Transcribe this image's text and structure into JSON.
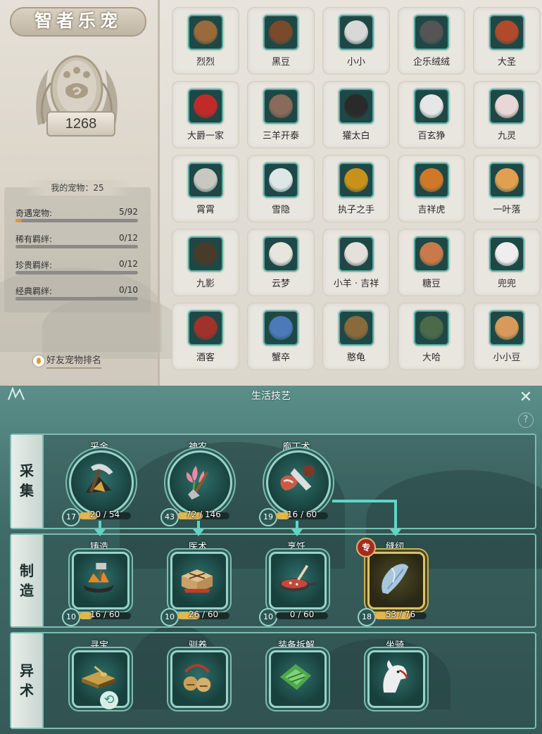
{
  "pet_panel": {
    "title": "智者乐宠",
    "score": "1268",
    "my_pets_label": "我的宠物：25",
    "stats": [
      {
        "label": "奇遇宠物:",
        "value": "5/92",
        "progress": 0.054
      },
      {
        "label": "稀有羁绊:",
        "value": "0/12",
        "progress": 0
      },
      {
        "label": "珍贵羁绊:",
        "value": "0/12",
        "progress": 0
      },
      {
        "label": "经典羁绊:",
        "value": "0/10",
        "progress": 0
      }
    ],
    "friend_rank": "好友宠物排名",
    "pets": [
      {
        "name": "烈烈",
        "color": "#9a6a3a",
        "icon": "horse-icon"
      },
      {
        "name": "黑豆",
        "color": "#7a4a2a",
        "icon": "guinea-pig-icon"
      },
      {
        "name": "小小",
        "color": "#d8d8d8",
        "icon": "goat-icon"
      },
      {
        "name": "企乐绒绒",
        "color": "#555555",
        "icon": "penguin-icon"
      },
      {
        "name": "大圣",
        "color": "#b04a2a",
        "icon": "monkey-icon"
      },
      {
        "name": "大爵一家",
        "color": "#c22a2a",
        "icon": "parrot-icon"
      },
      {
        "name": "三羊开泰",
        "color": "#8a6a5a",
        "icon": "sheep-icon"
      },
      {
        "name": "獾太白",
        "color": "#2a2a2a",
        "icon": "badger-icon"
      },
      {
        "name": "百玄狰",
        "color": "#e6e6e6",
        "icon": "white-beast-icon"
      },
      {
        "name": "九灵",
        "color": "#e9d6d6",
        "icon": "fox-icon"
      },
      {
        "name": "霄霄",
        "color": "#c8c8c0",
        "icon": "owl-icon"
      },
      {
        "name": "雪隐",
        "color": "#dfe6e8",
        "icon": "snow-wolf-icon"
      },
      {
        "name": "执子之手",
        "color": "#c8921a",
        "icon": "lantern-icon"
      },
      {
        "name": "吉祥虎",
        "color": "#d0782a",
        "icon": "tiger-icon"
      },
      {
        "name": "一叶落",
        "color": "#e0a050",
        "icon": "corgi-icon"
      },
      {
        "name": "九影",
        "color": "#4a3a2a",
        "icon": "deer-icon"
      },
      {
        "name": "云梦",
        "color": "#e6e6dc",
        "icon": "white-deer-icon"
      },
      {
        "name": "小羊 · 吉祥",
        "color": "#e4e0dc",
        "icon": "lamb-icon"
      },
      {
        "name": "糖豆",
        "color": "#c87a4a",
        "icon": "hamster-icon"
      },
      {
        "name": "兜兜",
        "color": "#eeeeee",
        "icon": "white-cat-icon"
      },
      {
        "name": "酒客",
        "color": "#a0322a",
        "icon": "bird-icon"
      },
      {
        "name": "蟹卒",
        "color": "#4a7ab8",
        "icon": "crab-icon"
      },
      {
        "name": "憨龟",
        "color": "#8a6a3a",
        "icon": "turtle-icon"
      },
      {
        "name": "大哈",
        "color": "#4a6a4a",
        "icon": "frog-icon"
      },
      {
        "name": "小小豆",
        "color": "#d89a5a",
        "icon": "small-hamster-icon"
      }
    ]
  },
  "skills_panel": {
    "title": "生活技艺",
    "close_glyph": "✕",
    "help_glyph": "?",
    "sections": {
      "gather": {
        "label_top": "采",
        "label_bottom": "集"
      },
      "craft": {
        "label_top": "制",
        "label_bottom": "造"
      },
      "special": {
        "label_top": "异",
        "label_bottom": "术"
      }
    },
    "gather_skills": [
      {
        "name": "采金",
        "level": "17",
        "xp": "20 / 54",
        "progress": 0.37,
        "icon": "pickaxe-icon"
      },
      {
        "name": "神农",
        "level": "43",
        "xp": "72 / 146",
        "progress": 0.49,
        "icon": "herb-shovel-icon"
      },
      {
        "name": "庖丁术",
        "level": "19",
        "xp": "16 / 60",
        "progress": 0.27,
        "icon": "butcher-knife-icon"
      }
    ],
    "craft_skills": [
      {
        "name": "铸造",
        "level": "10",
        "xp": "16 / 60",
        "progress": 0.27,
        "icon": "anvil-hammer-icon"
      },
      {
        "name": "医术",
        "level": "10",
        "xp": "26 / 60",
        "progress": 0.43,
        "icon": "medicine-box-icon"
      },
      {
        "name": "烹饪",
        "level": "10",
        "xp": "0 / 60",
        "progress": 0,
        "icon": "wok-icon"
      },
      {
        "name": "缝纫",
        "level": "18",
        "xp": "53 / 76",
        "progress": 0.7,
        "icon": "sewing-icon",
        "spec": "专"
      }
    ],
    "special_skills": [
      {
        "name": "寻宝",
        "icon": "treasure-table-icon"
      },
      {
        "name": "驯养",
        "icon": "bells-icon"
      },
      {
        "name": "装备拆解",
        "icon": "green-jade-icon"
      },
      {
        "name": "坐骑",
        "icon": "white-horse-icon"
      }
    ]
  }
}
